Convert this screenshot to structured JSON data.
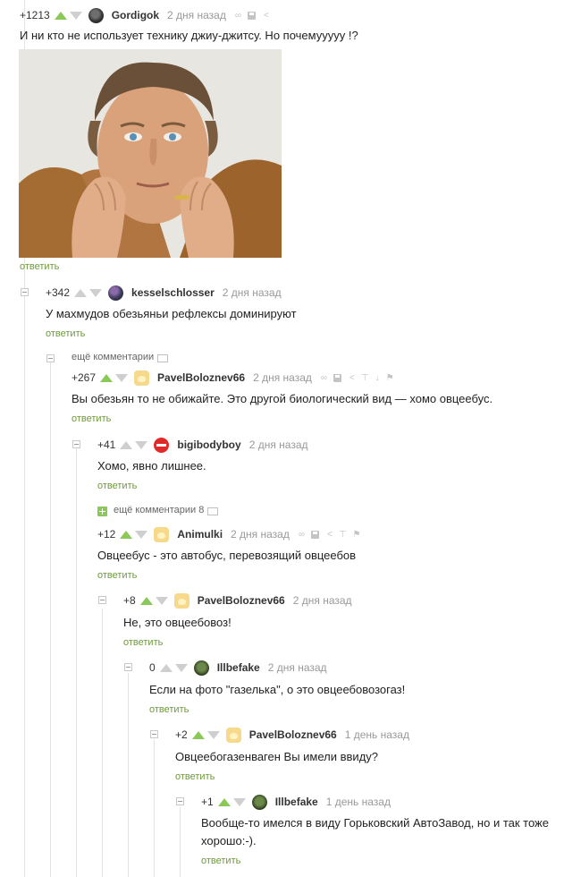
{
  "comments": [
    {
      "rating": "+1213",
      "username": "Gordigok",
      "time": "2 дня назад",
      "text": "И ни кто не использует технику джиу-джитсу. Но почемууууу !?",
      "reply": "ответить"
    },
    {
      "rating": "+342",
      "username": "kesselschlosser",
      "time": "2 дня назад",
      "text": "У махмудов обезьяньи рефлексы  доминируют",
      "reply": "ответить"
    },
    {
      "rating": "+267",
      "username": "PavelBoloznev66",
      "time": "2 дня назад",
      "text": "Вы обезьян то не обижайте. Это другой биологический вид — хомо овцеебус.",
      "reply": "ответить"
    },
    {
      "rating": "+41",
      "username": "bigibodyboy",
      "time": "2 дня назад",
      "text": "Хомо, явно лишнее.",
      "reply": "ответить"
    },
    {
      "rating": "+12",
      "username": "Animulki",
      "time": "2 дня назад",
      "text": "Овцеебус - это автобус, перевозящий овцеебов",
      "reply": "ответить"
    },
    {
      "rating": "+8",
      "username": "PavelBoloznev66",
      "time": "2 дня назад",
      "text": "Не, это овцеебовоз!",
      "reply": "ответить"
    },
    {
      "rating": "0",
      "username": "Illbefake",
      "time": "2 дня назад",
      "text": "Если на фото \"газелька\", о это овцеебовозогаз!",
      "reply": "ответить"
    },
    {
      "rating": "+2",
      "username": "PavelBoloznev66",
      "time": "1 день назад",
      "text": "Овцеебогазенваген Вы имели ввиду?",
      "reply": "ответить"
    },
    {
      "rating": "+1",
      "username": "Illbefake",
      "time": "1 день назад",
      "text": "Вообще-то имелся в виду Горьковский АвтоЗавод, но и так тоже хорошо:-).",
      "reply": "ответить"
    }
  ],
  "more_comments": [
    "ещё комментарии",
    "ещё комментарии 8"
  ],
  "icons": {
    "vote_up": "arrow-up-icon",
    "vote_down": "arrow-down-icon",
    "link": "link-icon",
    "save": "save-icon",
    "share": "share-icon",
    "pin": "pin-icon",
    "download": "download-icon",
    "report": "flag-icon",
    "comment": "comment-icon"
  },
  "colors": {
    "accent": "#8ac858",
    "reply": "#6e9a3c",
    "muted": "#999999",
    "line": "#e3e3e3"
  }
}
